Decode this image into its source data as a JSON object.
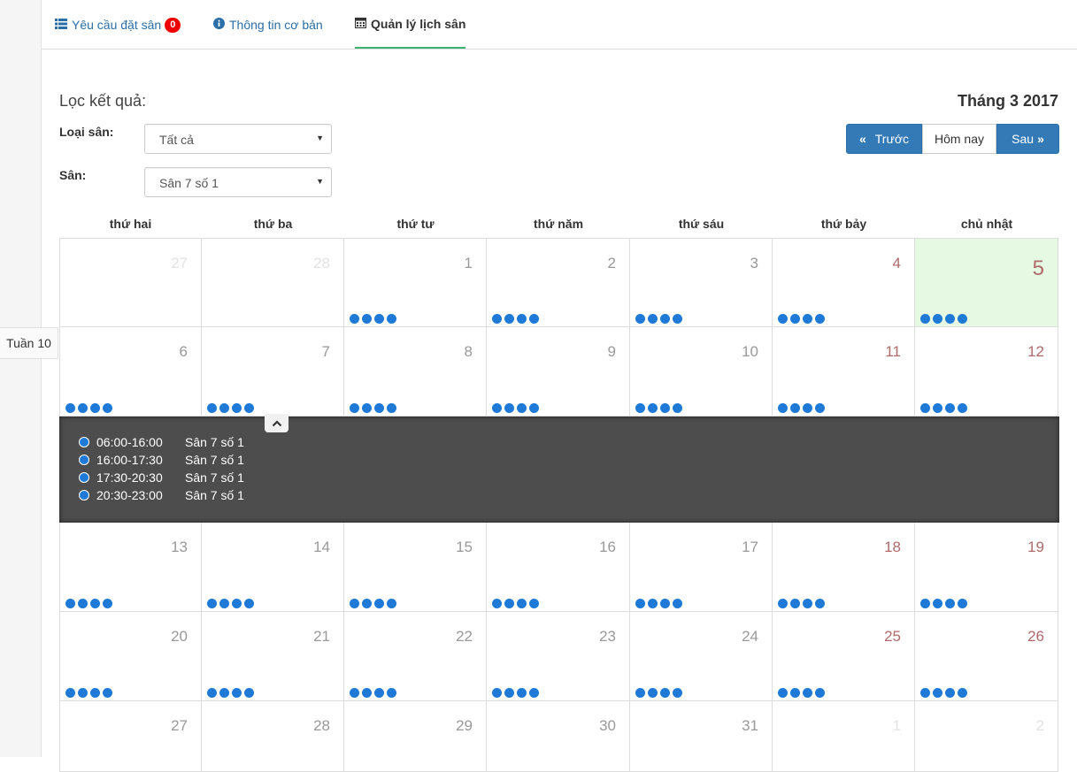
{
  "tabs": [
    {
      "label": "Yêu cầu đặt sân",
      "icon": "list-icon",
      "badge": "0"
    },
    {
      "label": "Thông tin cơ bản",
      "icon": "info-circle-icon"
    },
    {
      "label": "Quản lý lịch sân",
      "icon": "calendar-icon",
      "active": true
    }
  ],
  "filter": {
    "title": "Lọc kết quả:",
    "type_label": "Loại sân:",
    "type_value": "Tất cả",
    "field_label": "Sân:",
    "field_value": "Sân 7 số 1"
  },
  "calendar": {
    "month_title": "Tháng 3 2017",
    "prev_label": "Trước",
    "today_label": "Hôm nay",
    "next_label": "Sau",
    "week_label": "Tuần 10",
    "weekdays": [
      "thứ hai",
      "thứ ba",
      "thứ tư",
      "thứ năm",
      "thứ sáu",
      "thứ bảy",
      "chủ nhật"
    ],
    "weeks": [
      [
        "27",
        "28",
        "1",
        "2",
        "3",
        "4",
        "5"
      ],
      [
        "6",
        "7",
        "8",
        "9",
        "10",
        "11",
        "12"
      ],
      [
        "13",
        "14",
        "15",
        "16",
        "17",
        "18",
        "19"
      ],
      [
        "20",
        "21",
        "22",
        "23",
        "24",
        "25",
        "26"
      ],
      [
        "27",
        "28",
        "29",
        "30",
        "31",
        "1",
        "2"
      ]
    ],
    "today": "5",
    "detail_slots": [
      {
        "time": "06:00-16:00",
        "field": "Sân 7 số 1"
      },
      {
        "time": "16:00-17:30",
        "field": "Sân 7 số 1"
      },
      {
        "time": "17:30-20:30",
        "field": "Sân 7 số 1"
      },
      {
        "time": "20:30-23:00",
        "field": "Sân 7 số 1"
      }
    ]
  },
  "colors": {
    "accent": "#337ab7",
    "dot": "#1e7ad6",
    "today_bg": "#e6fae3",
    "badge": "#ee0000",
    "active_tab_underline": "#3cb371"
  }
}
